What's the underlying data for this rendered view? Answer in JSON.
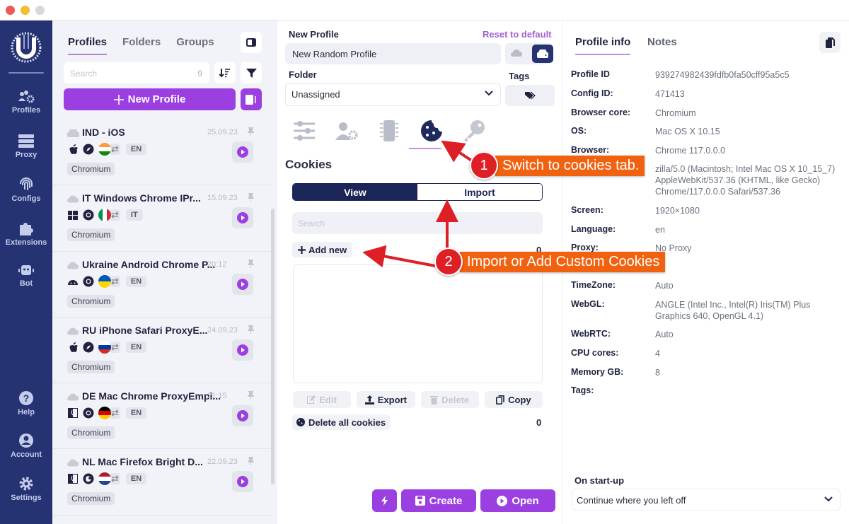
{
  "window": {
    "controls": [
      "close",
      "minimize",
      "zoom"
    ]
  },
  "nav": {
    "items_top": [
      {
        "label": "Profiles",
        "icon": "users-gear-icon"
      },
      {
        "label": "Proxy",
        "icon": "server-icon"
      },
      {
        "label": "Configs",
        "icon": "fingerprint-icon"
      },
      {
        "label": "Extensions",
        "icon": "puzzle-icon"
      },
      {
        "label": "Bot",
        "icon": "robot-icon"
      }
    ],
    "items_bottom": [
      {
        "label": "Help",
        "icon": "question-icon"
      },
      {
        "label": "Account",
        "icon": "user-circle-icon"
      },
      {
        "label": "Settings",
        "icon": "gear-icon"
      }
    ]
  },
  "profiles_panel": {
    "tabs": [
      "Profiles",
      "Folders",
      "Groups"
    ],
    "active_tab": "Profiles",
    "search_placeholder": "Search",
    "search_count": "9",
    "new_profile_label": "New Profile",
    "items": [
      {
        "name": "IND - iOS",
        "date": "25.09.23",
        "storage": "local",
        "os": "apple",
        "browser": "safari",
        "country": "IN",
        "lang": "EN",
        "core": "Chromium"
      },
      {
        "name": "IT Windows Chrome IPr...",
        "date": "15.09.23",
        "storage": "cloud",
        "os": "windows",
        "browser": "chrome",
        "country": "IT",
        "lang": "IT",
        "core": "Chromium"
      },
      {
        "name": "Ukraine Android Chrome P...",
        "date": "20:12",
        "storage": "cloud",
        "os": "android",
        "browser": "chrome",
        "country": "UA",
        "lang": "EN",
        "core": "Chromium"
      },
      {
        "name": "RU iPhone Safari ProxyE...",
        "date": "24.09.23",
        "storage": "cloud",
        "os": "apple",
        "browser": "safari",
        "country": "RU",
        "lang": "EN",
        "core": "Chromium"
      },
      {
        "name": "DE Mac Chrome ProxyEmpi...",
        "date": "21:15",
        "storage": "cloud",
        "os": "mac",
        "browser": "chrome",
        "country": "DE",
        "lang": "EN",
        "core": "Chromium"
      },
      {
        "name": "NL Mac Firefox Bright D...",
        "date": "22.09.23",
        "storage": "cloud",
        "os": "mac",
        "browser": "firefox",
        "country": "NL",
        "lang": "EN",
        "core": "Chromium"
      }
    ]
  },
  "editor": {
    "name_label": "New Profile",
    "reset_label": "Reset to default",
    "name_value": "New Random Profile",
    "folder_label": "Folder",
    "folder_value": "Unassigned",
    "tags_label": "Tags",
    "section_tabs": [
      {
        "icon": "sliders-icon",
        "active": false
      },
      {
        "icon": "user-gear-icon",
        "active": false
      },
      {
        "icon": "chip-icon",
        "active": false
      },
      {
        "icon": "cookie-icon",
        "active": true
      },
      {
        "icon": "key-icon",
        "active": false
      }
    ],
    "cookies": {
      "title": "Cookies",
      "modes": [
        "View",
        "Import"
      ],
      "active_mode": "View",
      "search_placeholder": "Search",
      "add_new_label": "Add new",
      "count": "0",
      "actions": [
        {
          "label": "Edit",
          "icon": "edit-icon",
          "enabled": false
        },
        {
          "label": "Export",
          "icon": "export-icon",
          "enabled": true
        },
        {
          "label": "Delete",
          "icon": "trash-icon",
          "enabled": false
        },
        {
          "label": "Copy",
          "icon": "copy-icon",
          "enabled": true
        }
      ],
      "delete_all_label": "Delete all cookies",
      "delete_all_count": "0"
    },
    "footer": {
      "quick_icon": "bolt-icon",
      "create_label": "Create",
      "open_label": "Open"
    }
  },
  "info": {
    "tabs": [
      "Profile info",
      "Notes"
    ],
    "active_tab": "Profile info",
    "rows": [
      {
        "key": "Profile ID",
        "value": "939274982439fdfb0fa50cff95a5c5"
      },
      {
        "key": "Config ID:",
        "value": "471413"
      },
      {
        "key": "Browser core:",
        "value": "Chromium"
      },
      {
        "key": "OS:",
        "value": "Mac OS X 10.15"
      },
      {
        "key": "Browser:",
        "value": "Chrome 117.0.0.0"
      },
      {
        "key": "",
        "value": "zilla/5.0 (Macintosh; Intel Mac OS X 10_15_7) AppleWebKit/537.36 (KHTML, like Gecko) Chrome/117.0.0.0 Safari/537.36"
      },
      {
        "key": "Screen:",
        "value": "1920×1080"
      },
      {
        "key": "Language:",
        "value": "en"
      },
      {
        "key": "Proxy:",
        "value": "No Proxy"
      },
      {
        "key": "TimeZone:",
        "value": "Auto"
      },
      {
        "key": "WebGL:",
        "value": "ANGLE (Intel Inc., Intel(R) Iris(TM) Plus Graphics 640, OpenGL 4.1)"
      },
      {
        "key": "WebRTC:",
        "value": "Auto"
      },
      {
        "key": "CPU cores:",
        "value": "4"
      },
      {
        "key": "Memory GB:",
        "value": "8"
      },
      {
        "key": "Tags:",
        "value": ""
      }
    ],
    "startup_label": "On start-up",
    "startup_value": "Continue where you left off"
  },
  "annotations": [
    {
      "number": "1",
      "text": "Switch to cookies tab."
    },
    {
      "number": "2",
      "text": "Import or Add Custom Cookies"
    }
  ],
  "colors": {
    "accent": "#9b3fe0",
    "nav_bg": "#253372",
    "navy": "#1b2556",
    "callout_orange": "#f0620f",
    "callout_red": "#de1f26"
  }
}
